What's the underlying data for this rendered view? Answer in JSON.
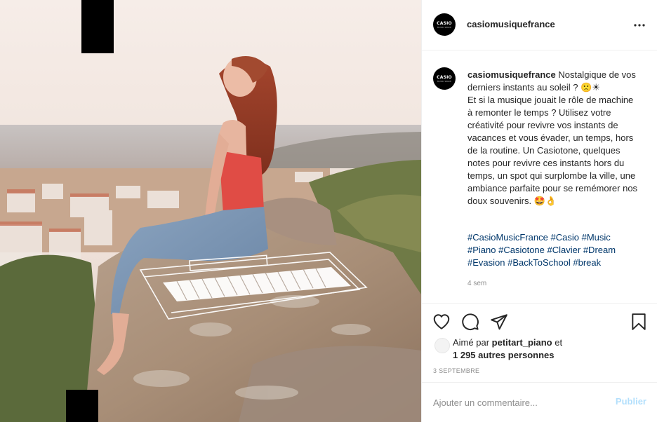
{
  "post": {
    "username": "casiomusiquefrance",
    "avatar_logo": {
      "main": "CASIO",
      "sub": "MUSIC SPACE"
    },
    "caption": "Nostalgique de vos derniers instants au soleil ? 🙁☀\nEt si la musique jouait le rôle de machine à remonter le temps ? Utilisez votre créativité pour revivre vos instants de vacances et vous évader, un temps, hors de la routine. Un Casiotone, quelques notes pour revivre ces instants hors du temps, un spot qui surplombe la ville, une ambiance parfaite pour se remémorer nos doux souvenirs. 🤩👌",
    "hashtags": [
      "#CasioMusicFrance",
      "#Casio",
      "#Music",
      "#Piano",
      "#Casiotone",
      "#Clavier",
      "#Dream",
      "#Evasion",
      "#BackToSchool",
      "#break"
    ],
    "time_ago": "4 sem",
    "likes": {
      "prefix": "Aimé par",
      "user": "petitart_piano",
      "connector": "et",
      "others": "1 295 autres personnes"
    },
    "date": "3 SEPTEMBRE"
  },
  "comment": {
    "placeholder": "Ajouter un commentaire...",
    "publish_label": "Publier"
  },
  "icons": {
    "more": "more-options-icon",
    "like": "heart-icon",
    "comment": "comment-icon",
    "share": "paper-plane-icon",
    "save": "bookmark-icon"
  },
  "colors": {
    "link": "#00376b",
    "muted": "#8e8e8e",
    "publish_disabled": "#b2dffc"
  }
}
